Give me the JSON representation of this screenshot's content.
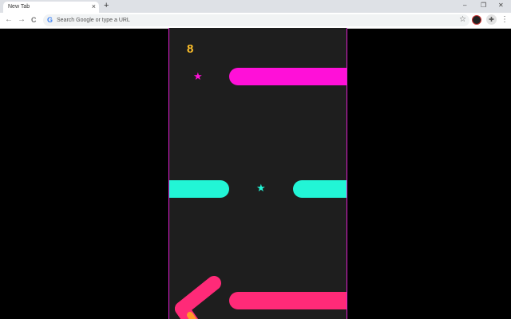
{
  "browser": {
    "tab_title": "New Tab",
    "tab_close": "×",
    "new_tab": "+",
    "minimize": "–",
    "restore": "❐",
    "close": "✕",
    "back": "←",
    "forward": "→",
    "reload": "C",
    "google_glyph": "G",
    "omnibox_placeholder": "Search Google or type a URL",
    "bookmark_star": "☆",
    "extensions": "✚",
    "menu": "⋮"
  },
  "game": {
    "score": "8",
    "colors": {
      "magenta": "#ff10d8",
      "cyan": "#22f5d6",
      "pink": "#ff2a78",
      "orange": "#ff9a2a",
      "background": "#1e1e1e",
      "border": "#e020d0"
    },
    "stars": [
      {
        "glyph": "★",
        "color": "magenta"
      },
      {
        "glyph": "★",
        "color": "cyan"
      }
    ]
  }
}
